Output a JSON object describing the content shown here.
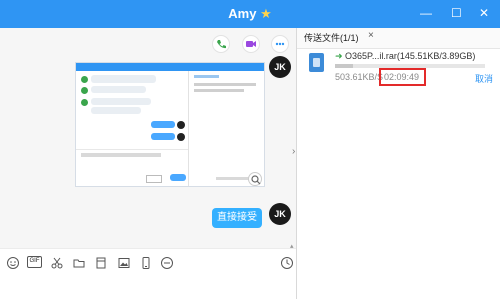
{
  "window": {
    "title": "Amy",
    "title_star": "★"
  },
  "window_controls": {
    "minimize": "—",
    "maximize": "☐",
    "close": "✕"
  },
  "chat": {
    "avatar_initials": "JK",
    "sent_message": "直接接受"
  },
  "transfer_panel": {
    "tab_label": "传送文件(1/1)",
    "tab_close": "×",
    "file_name": "O365P...il.rar(145.51KB/3.89GB)",
    "speed": "503.61KB/S",
    "time_remaining": "02:09:49",
    "cancel_label": "取消",
    "progress_fraction": 0.12
  },
  "colors": {
    "accent": "#2f95f3",
    "bubble": "#34b0ff",
    "highlight_box": "#e32a2a"
  }
}
